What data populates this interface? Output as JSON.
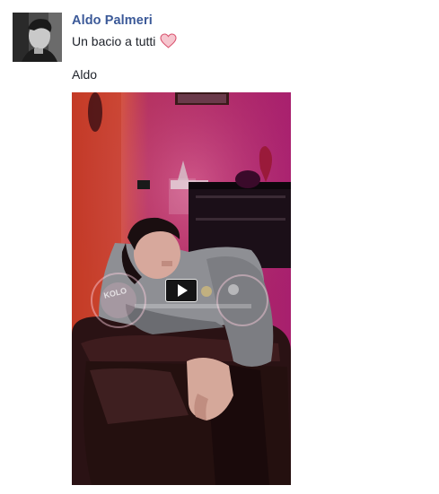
{
  "post": {
    "author_name": "Aldo Palmeri",
    "message": "Un bacio a tutti",
    "message_emoji": "heart-icon",
    "signature": "Aldo",
    "avatar_icon": "profile-photo",
    "video": {
      "play_icon": "play-icon",
      "watermark_text": "KOLO"
    }
  },
  "colors": {
    "author_link": "#3b5998",
    "text": "#1d2129",
    "heart_fill": "#f6c6cf",
    "heart_stroke": "#d9536f",
    "video_wall": "#b12a68",
    "video_accent": "#e5503a"
  }
}
